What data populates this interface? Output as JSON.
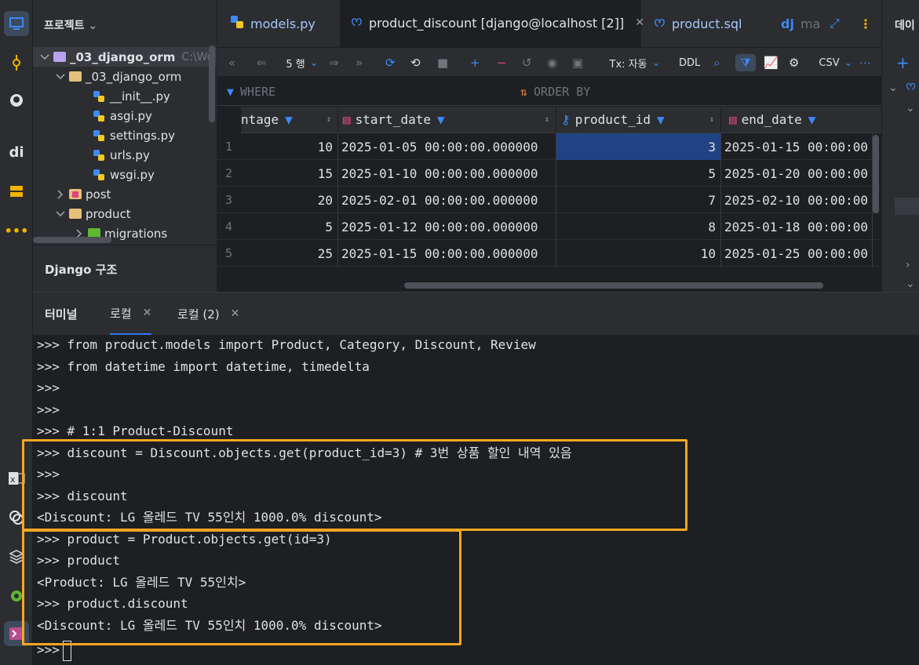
{
  "project_panel": {
    "title": "프로젝트",
    "tree": [
      {
        "label": "_03_django_orm",
        "hint": "C:\\Wo",
        "type": "root"
      },
      {
        "label": "_03_django_orm",
        "type": "folder"
      },
      {
        "label": "__init__.py",
        "type": "py"
      },
      {
        "label": "asgi.py",
        "type": "py"
      },
      {
        "label": "settings.py",
        "type": "py"
      },
      {
        "label": "urls.py",
        "type": "py"
      },
      {
        "label": "wsgi.py",
        "type": "py"
      },
      {
        "label": "post",
        "type": "app"
      },
      {
        "label": "product",
        "type": "folder"
      },
      {
        "label": "migrations",
        "type": "pkg"
      }
    ],
    "structure_title": "Django 구조"
  },
  "editor_tabs": [
    {
      "label": "models.py",
      "icon": "python-icon"
    },
    {
      "label": "product_discount [django@localhost [2]]",
      "icon": "mysql-dolphin-icon",
      "active": true
    },
    {
      "label": "product.sql",
      "icon": "mysql-dolphin-icon"
    },
    {
      "label": "ma",
      "icon": "django-icon"
    }
  ],
  "toolbar": {
    "rows_label": "5 행",
    "tx_label": "Tx: 자동",
    "ddl_label": "DDL",
    "csv_label": "CSV"
  },
  "filters": {
    "where": "WHERE",
    "order_by": "ORDER BY"
  },
  "grid": {
    "columns": [
      "ntage",
      "start_date",
      "product_id",
      "end_date"
    ],
    "rows": [
      {
        "n": "1",
        "percentage": "10",
        "start_date": "2025-01-05 00:00:00.000000",
        "product_id": "3",
        "end_date": "2025-01-15 00:00:00"
      },
      {
        "n": "2",
        "percentage": "15",
        "start_date": "2025-01-10 00:00:00.000000",
        "product_id": "5",
        "end_date": "2025-01-20 00:00:00"
      },
      {
        "n": "3",
        "percentage": "20",
        "start_date": "2025-02-01 00:00:00.000000",
        "product_id": "7",
        "end_date": "2025-02-10 00:00:00"
      },
      {
        "n": "4",
        "percentage": "5",
        "start_date": "2025-01-12 00:00:00.000000",
        "product_id": "8",
        "end_date": "2025-01-18 00:00:00"
      },
      {
        "n": "5",
        "percentage": "25",
        "start_date": "2025-01-15 00:00:00.000000",
        "product_id": "10",
        "end_date": "2025-01-25 00:00:00"
      }
    ]
  },
  "right_panel": {
    "title": "데이"
  },
  "terminal": {
    "tabs": [
      {
        "label": "터미널"
      },
      {
        "label": "로컬",
        "active": true
      },
      {
        "label": "로컬 (2)"
      }
    ],
    "lines": [
      ">>> from product.models import Product, Category, Discount, Review",
      ">>> from datetime import datetime, timedelta",
      ">>>",
      ">>>",
      ">>> # 1:1 Product-Discount",
      ">>> discount = Discount.objects.get(product_id=3) # 3번 상품 할인 내역 있음",
      ">>>",
      ">>> discount",
      "<Discount: LG 올레드 TV 55인치 1000.0% discount>",
      ">>> product = Product.objects.get(id=3)",
      ">>> product",
      "<Product: LG 올레드 TV 55인치>",
      ">>> product.discount",
      "<Discount: LG 올레드 TV 55인치 1000.0% discount>",
      ">>>"
    ]
  },
  "colors": {
    "highlight": "#f5a623",
    "selected_cell": "#214283",
    "accent": "#3574f0"
  }
}
